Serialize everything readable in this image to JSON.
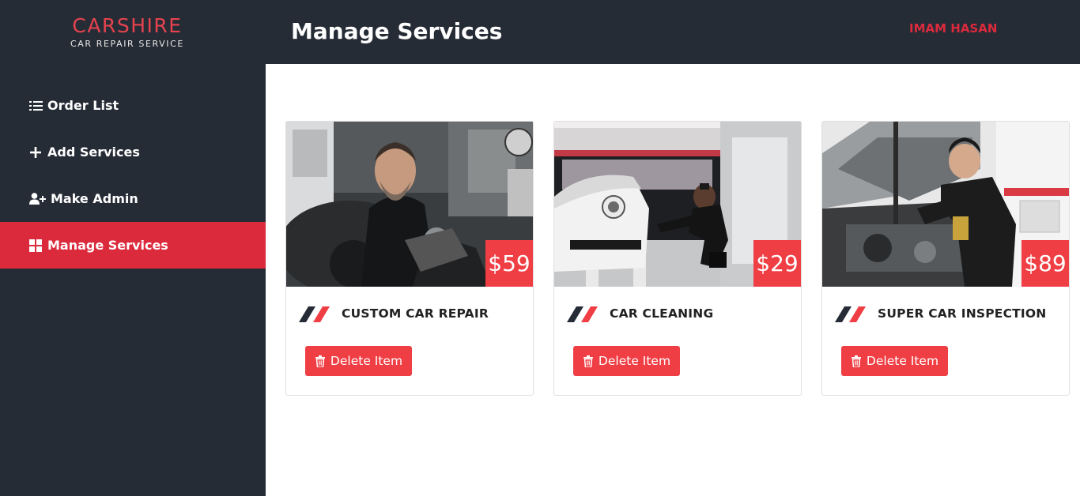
{
  "brand": {
    "name": "CARSHIRE",
    "tagline": "CAR REPAIR SERVICE"
  },
  "sidebar": {
    "items": [
      {
        "label": "Order List",
        "icon": "list-icon",
        "active": false
      },
      {
        "label": "Add Services",
        "icon": "plus-icon",
        "active": false
      },
      {
        "label": "Make Admin",
        "icon": "user-plus-icon",
        "active": false
      },
      {
        "label": "Manage Services",
        "icon": "grid-icon",
        "active": true
      }
    ]
  },
  "header": {
    "title": "Manage Services",
    "user": "IMAM HASAN"
  },
  "services": [
    {
      "title": "CUSTOM CAR REPAIR",
      "price": "$59",
      "delete_label": "Delete Item",
      "image": "mechanic-repairing-engine"
    },
    {
      "title": "CAR CLEANING",
      "price": "$29",
      "delete_label": "Delete Item",
      "image": "washing-white-porsche"
    },
    {
      "title": "SUPER CAR INSPECTION",
      "price": "$89",
      "delete_label": "Delete Item",
      "image": "mechanic-under-hood"
    }
  ],
  "colors": {
    "sidebar_bg": "#262c36",
    "accent": "#dc2a3d",
    "price_bg": "#ef3e44"
  }
}
